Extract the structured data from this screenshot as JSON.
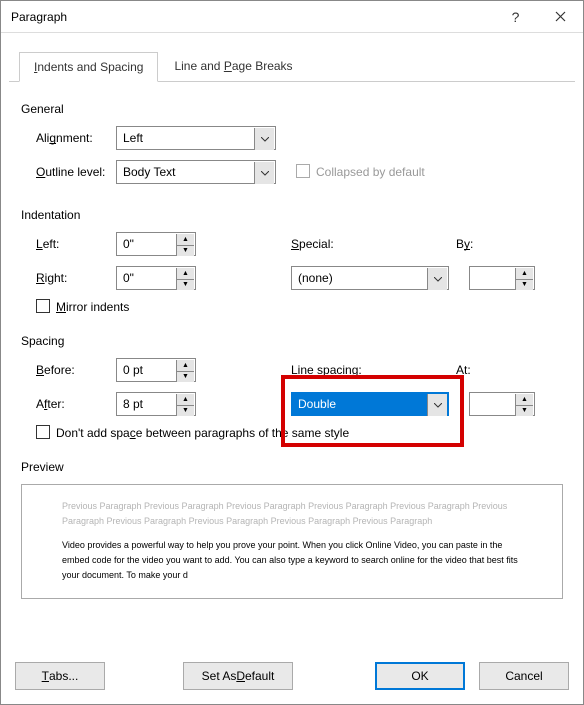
{
  "title": "Paragraph",
  "tabs": {
    "indents": "Indents and Spacing",
    "breaks": "Line and Page Breaks"
  },
  "general": {
    "header": "General",
    "alignment_label": "Alignment:",
    "alignment_value": "Left",
    "outline_label": "Outline level:",
    "outline_value": "Body Text",
    "collapsed_label": "Collapsed by default"
  },
  "indentation": {
    "header": "Indentation",
    "left_label": "Left:",
    "left_value": "0\"",
    "right_label": "Right:",
    "right_value": "0\"",
    "special_label": "Special:",
    "special_value": "(none)",
    "by_label": "By:",
    "by_value": "",
    "mirror_label": "Mirror indents"
  },
  "spacing": {
    "header": "Spacing",
    "before_label": "Before:",
    "before_value": "0 pt",
    "after_label": "After:",
    "after_value": "8 pt",
    "line_label": "Line spacing:",
    "line_value": "Double",
    "at_label": "At:",
    "at_value": "",
    "nospace_label": "Don't add space between paragraphs of the same style"
  },
  "preview": {
    "header": "Preview",
    "grey_text": "Previous Paragraph Previous Paragraph Previous Paragraph Previous Paragraph Previous Paragraph Previous Paragraph Previous Paragraph Previous Paragraph Previous Paragraph Previous Paragraph",
    "body_text": "Video provides a powerful way to help you prove your point. When you click Online Video, you can paste in the embed code for the video you want to add. You can also type a keyword to search online for the video that best fits your document. To make your d"
  },
  "footer": {
    "tabs": "Tabs...",
    "default": "Set As Default",
    "ok": "OK",
    "cancel": "Cancel"
  }
}
